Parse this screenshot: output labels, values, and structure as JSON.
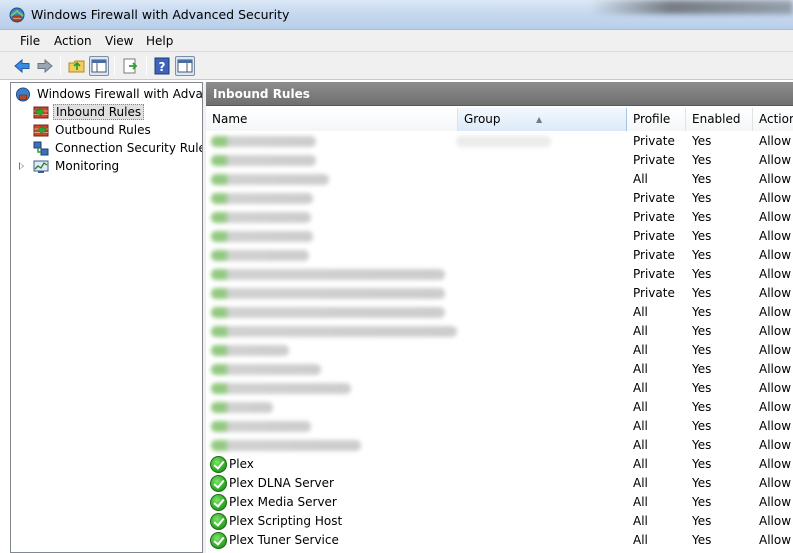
{
  "window": {
    "title": "Windows Firewall with Advanced Security"
  },
  "menu": [
    "File",
    "Action",
    "View",
    "Help"
  ],
  "toolbar": {
    "buttons": [
      "back-icon",
      "forward-icon",
      "up-folder-icon",
      "show-hide-console-tree-icon",
      "export-list-icon",
      "help-icon",
      "show-hide-action-pane-icon"
    ]
  },
  "tree": {
    "root": "Windows Firewall with Advanced Security",
    "items": [
      {
        "label": "Inbound Rules",
        "icon": "inbound-rules-icon"
      },
      {
        "label": "Outbound Rules",
        "icon": "outbound-rules-icon"
      },
      {
        "label": "Connection Security Rules",
        "icon": "connection-security-icon"
      },
      {
        "label": "Monitoring",
        "icon": "monitoring-icon"
      }
    ]
  },
  "content": {
    "header": "Inbound Rules",
    "columns": {
      "name": "Name",
      "group": "Group",
      "profile": "Profile",
      "enabled": "Enabled",
      "action": "Action"
    },
    "blurred_rows": [
      {
        "profile": "Private",
        "enabled": "Yes",
        "action": "Allow"
      },
      {
        "profile": "Private",
        "enabled": "Yes",
        "action": "Allow"
      },
      {
        "profile": "All",
        "enabled": "Yes",
        "action": "Allow"
      },
      {
        "profile": "Private",
        "enabled": "Yes",
        "action": "Allow"
      },
      {
        "profile": "Private",
        "enabled": "Yes",
        "action": "Allow"
      },
      {
        "profile": "Private",
        "enabled": "Yes",
        "action": "Allow"
      },
      {
        "profile": "Private",
        "enabled": "Yes",
        "action": "Allow"
      },
      {
        "profile": "Private",
        "enabled": "Yes",
        "action": "Allow"
      },
      {
        "profile": "Private",
        "enabled": "Yes",
        "action": "Allow"
      },
      {
        "profile": "All",
        "enabled": "Yes",
        "action": "Allow"
      },
      {
        "profile": "All",
        "enabled": "Yes",
        "action": "Allow"
      },
      {
        "profile": "All",
        "enabled": "Yes",
        "action": "Allow"
      },
      {
        "profile": "All",
        "enabled": "Yes",
        "action": "Allow"
      },
      {
        "profile": "All",
        "enabled": "Yes",
        "action": "Allow"
      },
      {
        "profile": "All",
        "enabled": "Yes",
        "action": "Allow"
      },
      {
        "profile": "All",
        "enabled": "Yes",
        "action": "Allow"
      },
      {
        "profile": "All",
        "enabled": "Yes",
        "action": "Allow"
      }
    ],
    "rules": [
      {
        "name": "Plex",
        "profile": "All",
        "enabled": "Yes",
        "action": "Allow"
      },
      {
        "name": "Plex DLNA Server",
        "profile": "All",
        "enabled": "Yes",
        "action": "Allow"
      },
      {
        "name": "Plex Media Server",
        "profile": "All",
        "enabled": "Yes",
        "action": "Allow"
      },
      {
        "name": "Plex Scripting Host",
        "profile": "All",
        "enabled": "Yes",
        "action": "Allow"
      },
      {
        "name": "Plex Tuner Service",
        "profile": "All",
        "enabled": "Yes",
        "action": "Allow"
      }
    ]
  },
  "colors": {
    "check_green": "#35b02a",
    "header_gray": "#7a7a7a",
    "titlebar": "#c7d9ef"
  }
}
